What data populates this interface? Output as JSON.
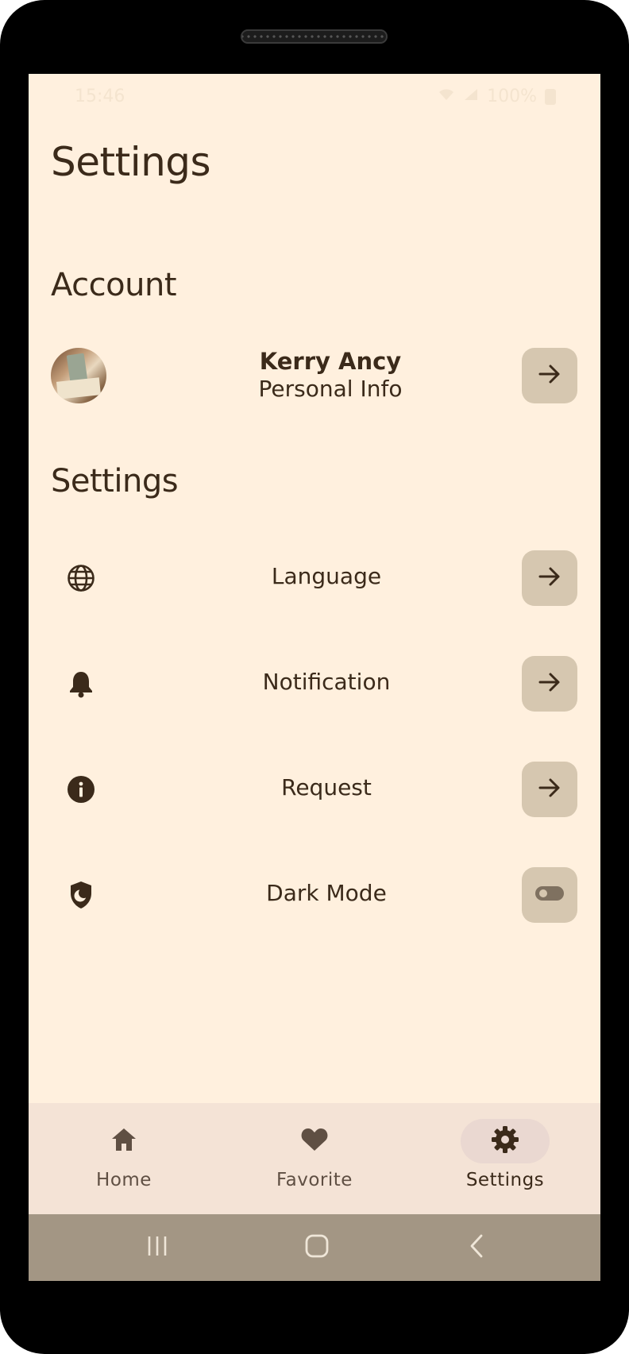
{
  "status_bar": {
    "time": "15:46",
    "battery": "100%"
  },
  "page": {
    "title": "Settings"
  },
  "account_section": {
    "title": "Account",
    "user_name": "Kerry Ancy",
    "subtitle": "Personal Info"
  },
  "settings_section": {
    "title": "Settings",
    "items": [
      {
        "label": "Language",
        "icon": "globe-icon",
        "action": "arrow-right-icon"
      },
      {
        "label": "Notification",
        "icon": "bell-icon",
        "action": "arrow-right-icon"
      },
      {
        "label": "Request",
        "icon": "info-icon",
        "action": "arrow-right-icon"
      },
      {
        "label": "Dark Mode",
        "icon": "dark-mode-shield-icon",
        "action": "toggle-icon"
      }
    ]
  },
  "bottom_nav": {
    "items": [
      {
        "label": "Home",
        "icon": "home-icon",
        "active": false
      },
      {
        "label": "Favorite",
        "icon": "heart-icon",
        "active": false
      },
      {
        "label": "Settings",
        "icon": "gear-icon",
        "active": true
      }
    ]
  },
  "colors": {
    "background": "#fff0de",
    "text": "#3b2a1a",
    "button_bg": "#d6c7b0",
    "nav_bg": "#f4e3d6",
    "nav_active_pill": "#ead8d1",
    "system_bar": "#a39684"
  }
}
